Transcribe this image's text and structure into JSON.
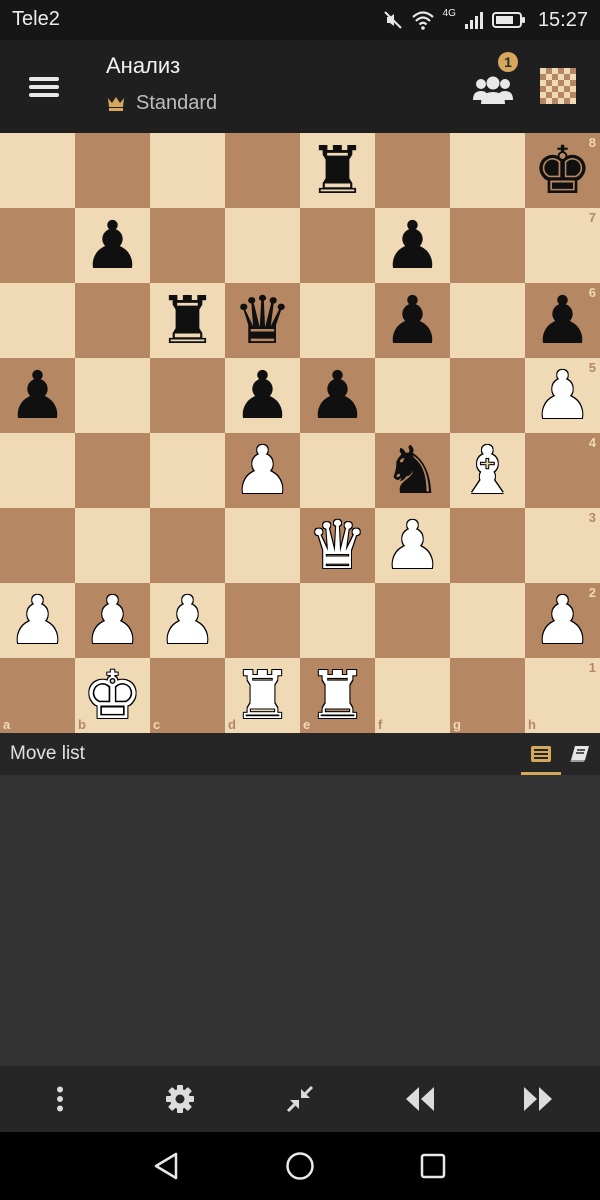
{
  "status_bar": {
    "carrier": "Tele2",
    "network_type": "4G",
    "time": "15:27",
    "icons": [
      "mute-icon",
      "wifi-icon",
      "signal-icon",
      "battery-icon"
    ]
  },
  "header": {
    "title": "Анализ",
    "variant": "Standard",
    "variant_icon": "crown-icon",
    "badge_count": "1",
    "icons": [
      "menu-icon",
      "users-icon",
      "board-icon"
    ]
  },
  "board": {
    "orientation": "white-bottom",
    "light_square": "#f0d9b5",
    "dark_square": "#b58863",
    "file_labels": [
      "a",
      "b",
      "c",
      "d",
      "e",
      "f",
      "g",
      "h"
    ],
    "rank_labels": [
      "8",
      "7",
      "6",
      "5",
      "4",
      "3",
      "2",
      "1"
    ],
    "pieces": [
      {
        "square": "e8",
        "color": "black",
        "type": "rook",
        "glyph": "♜"
      },
      {
        "square": "h8",
        "color": "black",
        "type": "king",
        "glyph": "♚"
      },
      {
        "square": "b7",
        "color": "black",
        "type": "pawn",
        "glyph": "♟"
      },
      {
        "square": "f7",
        "color": "black",
        "type": "pawn",
        "glyph": "♟"
      },
      {
        "square": "c6",
        "color": "black",
        "type": "rook",
        "glyph": "♜"
      },
      {
        "square": "d6",
        "color": "black",
        "type": "queen",
        "glyph": "♛"
      },
      {
        "square": "f6",
        "color": "black",
        "type": "pawn",
        "glyph": "♟"
      },
      {
        "square": "h6",
        "color": "black",
        "type": "pawn",
        "glyph": "♟"
      },
      {
        "square": "a5",
        "color": "black",
        "type": "pawn",
        "glyph": "♟"
      },
      {
        "square": "d5",
        "color": "black",
        "type": "pawn",
        "glyph": "♟"
      },
      {
        "square": "e5",
        "color": "black",
        "type": "pawn",
        "glyph": "♟"
      },
      {
        "square": "h5",
        "color": "white",
        "type": "pawn",
        "glyph": "♟"
      },
      {
        "square": "d4",
        "color": "white",
        "type": "pawn",
        "glyph": "♟"
      },
      {
        "square": "f4",
        "color": "black",
        "type": "knight",
        "glyph": "♞"
      },
      {
        "square": "g4",
        "color": "white",
        "type": "bishop",
        "glyph": "♝"
      },
      {
        "square": "e3",
        "color": "white",
        "type": "queen",
        "glyph": "♛"
      },
      {
        "square": "f3",
        "color": "white",
        "type": "pawn",
        "glyph": "♟"
      },
      {
        "square": "a2",
        "color": "white",
        "type": "pawn",
        "glyph": "♟"
      },
      {
        "square": "b2",
        "color": "white",
        "type": "pawn",
        "glyph": "♟"
      },
      {
        "square": "c2",
        "color": "white",
        "type": "pawn",
        "glyph": "♟"
      },
      {
        "square": "h2",
        "color": "white",
        "type": "pawn",
        "glyph": "♟"
      },
      {
        "square": "b1",
        "color": "white",
        "type": "king",
        "glyph": "♚"
      },
      {
        "square": "d1",
        "color": "white",
        "type": "rook",
        "glyph": "♜"
      },
      {
        "square": "e1",
        "color": "white",
        "type": "rook",
        "glyph": "♜"
      }
    ]
  },
  "move_list": {
    "title": "Move list",
    "tabs": [
      {
        "name": "move-list-tab",
        "icon": "list-icon",
        "active": true
      },
      {
        "name": "opening-book-tab",
        "icon": "book-icon",
        "active": false
      }
    ],
    "accent": "#d5a85b"
  },
  "toolbar": {
    "buttons": [
      "more-options-button",
      "settings-button",
      "minimize-button",
      "rewind-button",
      "fast-forward-button"
    ]
  },
  "nav_bar": {
    "buttons": [
      "back-button",
      "home-button",
      "recents-button"
    ]
  }
}
